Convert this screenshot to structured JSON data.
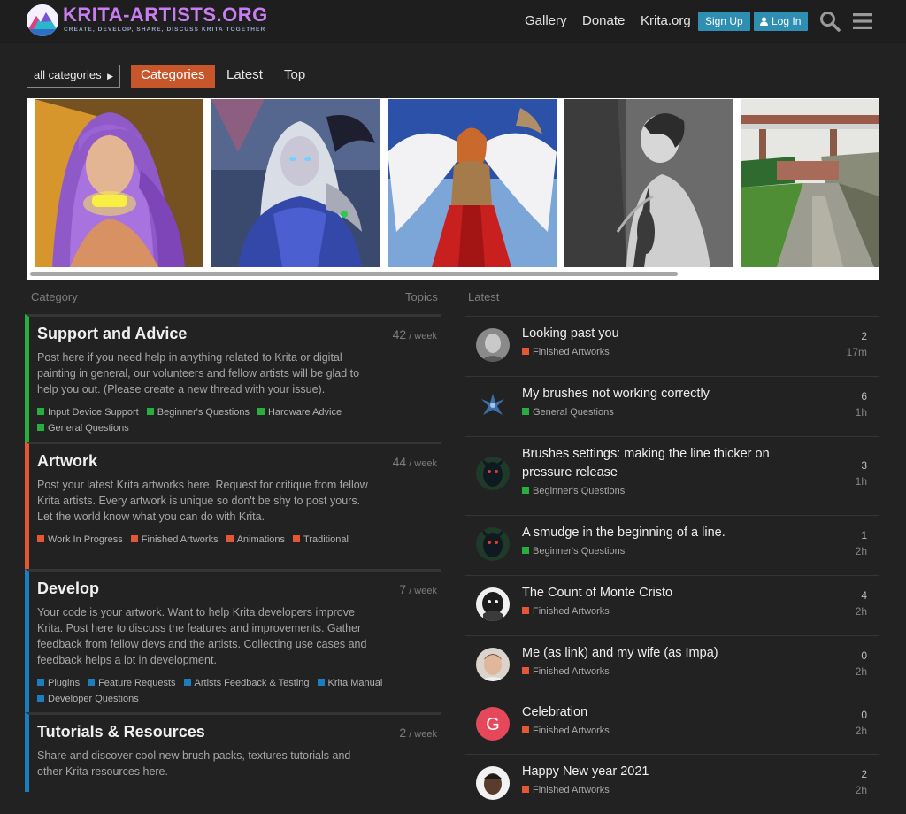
{
  "header": {
    "site_name": "KRITA-ARTISTS.ORG",
    "tagline": "CREATE, DEVELOP, SHARE, DISCUSS KRITA TOGETHER",
    "nav": [
      "Gallery",
      "Donate",
      "Krita.org"
    ],
    "signup_label": "Sign Up",
    "login_label": "Log In"
  },
  "filters": {
    "category_select": "all categories",
    "tabs": [
      "Categories",
      "Latest",
      "Top"
    ],
    "active_tab": "Categories"
  },
  "gallery": {
    "images": [
      "purple-hair-portrait",
      "white-haired-elf-warrior",
      "winged-angel-warrior",
      "grayscale-woman-with-violin",
      "railway-bridge-landscape"
    ]
  },
  "categories": {
    "header_label": "Category",
    "topics_label": "Topics",
    "items": [
      {
        "title": "Support and Advice",
        "count": "42",
        "period": " / week",
        "color": "#27ae3d",
        "description": "Post here if you need help in anything related to Krita or digital painting in general, our volunteers and fellow artists will be glad to help you out. (Please create a new thread with your issue).",
        "subcategories": [
          "Input Device Support",
          "Beginner's Questions",
          "Hardware Advice",
          "General Questions"
        ]
      },
      {
        "title": "Artwork",
        "count": "44",
        "period": " / week",
        "color": "#e45735",
        "description": "Post your latest Krita artworks here. Request for critique from fellow Krita artists. Every artwork is unique so don't be shy to post yours. Let the world know what you can do with Krita.",
        "subcategories": [
          "Work In Progress",
          "Finished Artworks",
          "Animations",
          "Traditional"
        ]
      },
      {
        "title": "Develop",
        "count": "7",
        "period": " / week",
        "color": "#1a7fc1",
        "description": "Your code is your artwork. Want to help Krita developers improve Krita. Post here to discuss the features and improvements. Gather feedback from fellow devs and the artists. Collecting use cases and feedback helps a lot in development.",
        "subcategories": [
          "Plugins",
          "Feature Requests",
          "Artists Feedback & Testing",
          "Krita Manual",
          "Developer Questions"
        ]
      },
      {
        "title": "Tutorials & Resources",
        "count": "2",
        "period": " / week",
        "color": "#1a7fc1",
        "description": "Share and discover cool new brush packs, textures tutorials and other Krita resources here.",
        "subcategories": []
      }
    ]
  },
  "latest": {
    "header_label": "Latest",
    "topics": [
      {
        "title": "Looking past you",
        "category": "Finished Artworks",
        "category_color": "#e45735",
        "replies": "2",
        "age": "17m",
        "avatar": "gray-portrait"
      },
      {
        "title": "My brushes not working correctly",
        "category": "General Questions",
        "category_color": "#27ae3d",
        "replies": "6",
        "age": "1h",
        "avatar": "blue-dragon-logo"
      },
      {
        "title": "Brushes settings: making the line thicker on pressure release",
        "category": "Beginner's Questions",
        "category_color": "#27ae3d",
        "replies": "3",
        "age": "1h",
        "avatar": "dark-creature-red"
      },
      {
        "title": "A smudge in the beginning of a line.",
        "category": "Beginner's Questions",
        "category_color": "#27ae3d",
        "replies": "1",
        "age": "2h",
        "avatar": "dark-creature-red"
      },
      {
        "title": "The Count of Monte Cristo",
        "category": "Finished Artworks",
        "category_color": "#e45735",
        "replies": "4",
        "age": "2h",
        "avatar": "bw-sketch"
      },
      {
        "title": "Me (as link) and my wife (as Impa)",
        "category": "Finished Artworks",
        "category_color": "#e45735",
        "replies": "0",
        "age": "2h",
        "avatar": "man-photo"
      },
      {
        "title": "Celebration",
        "category": "Finished Artworks",
        "category_color": "#e45735",
        "replies": "0",
        "age": "2h",
        "avatar": "letter-avatar",
        "avatar_letter": "G",
        "avatar_color": "#e5485a"
      },
      {
        "title": "Happy New year 2021",
        "category": "Finished Artworks",
        "category_color": "#e45735",
        "replies": "2",
        "age": "2h",
        "avatar": "man-photo-dark"
      }
    ]
  }
}
